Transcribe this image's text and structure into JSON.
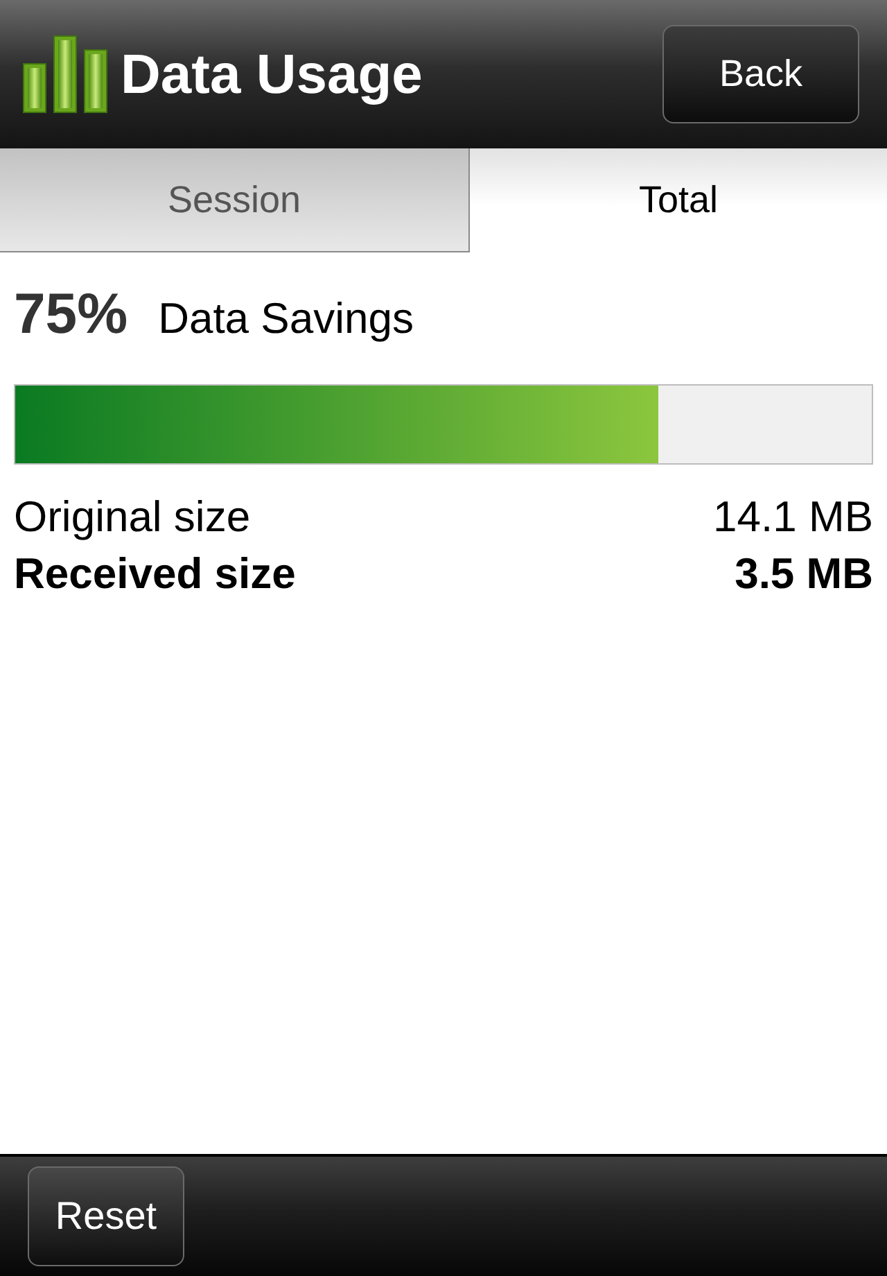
{
  "header": {
    "title": "Data Usage",
    "back_button": "Back"
  },
  "tabs": [
    {
      "label": "Session",
      "selected": false
    },
    {
      "label": "Total",
      "selected": true
    }
  ],
  "savings": {
    "percent": "75%",
    "label": "Data Savings",
    "level": 0.75
  },
  "rows": [
    {
      "label": "Original size",
      "value": "14.1 MB",
      "bold": false
    },
    {
      "label": "Received size",
      "value": "3.5 MB",
      "bold": true
    }
  ],
  "footer": {
    "reset_button": "Reset"
  }
}
